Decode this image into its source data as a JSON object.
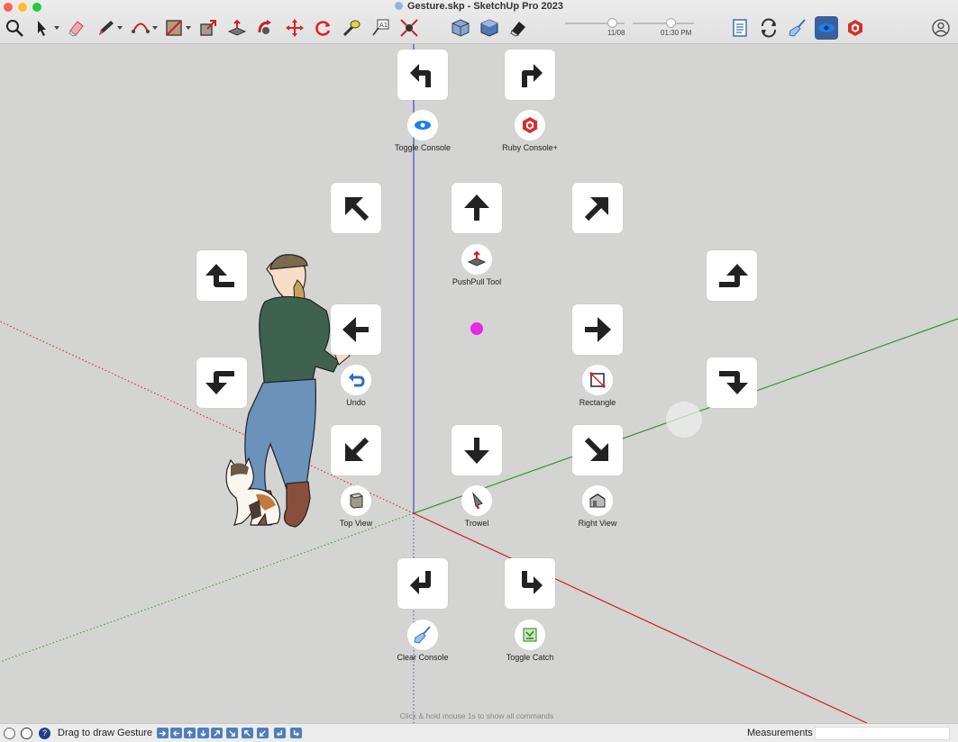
{
  "window": {
    "title": "Gesture.skp - SketchUp Pro 2023",
    "traffic_colors": [
      "#ff5f57",
      "#febc2e",
      "#28c840"
    ]
  },
  "toolbar": {
    "date_value": "11/08",
    "time_value": "01:30 PM",
    "tools": [
      "search-icon",
      "select-arrow-icon",
      "eraser-icon",
      "pencil-icon",
      "arc-icon",
      "rectangle-fill-icon",
      "scale-icon",
      "pushpull-icon",
      "follow-me-icon",
      "move-icon",
      "rotate-icon",
      "tape-measure-icon",
      "text-label-icon",
      "zoom-extents-icon",
      "iso-view-icon",
      "top-view-icon",
      "eraser-shadow-icon",
      "report-icon",
      "refresh-icon",
      "broom-icon",
      "eye-icon",
      "ruby-console-icon",
      "account-icon"
    ]
  },
  "viewport": {
    "hint": "Click & hold mouse 1s to show all commands",
    "axis_colors": {
      "blue": "#3b4ccf",
      "red": "#cc2222",
      "green": "#2f9a2f"
    },
    "accent_color": "#e829e0",
    "commands": [
      {
        "id": "toggle-console",
        "label": "Toggle Console",
        "icon": "eye-icon"
      },
      {
        "id": "ruby-console-plus",
        "label": "Ruby Console+",
        "icon": "ruby-icon"
      },
      {
        "id": "pushpull-tool",
        "label": "PushPull Tool",
        "icon": "pushpull-icon"
      },
      {
        "id": "undo",
        "label": "Undo",
        "icon": "undo-icon"
      },
      {
        "id": "rectangle",
        "label": "Rectangle",
        "icon": "rectangle-icon"
      },
      {
        "id": "top-view",
        "label": "Top View",
        "icon": "top-view-icon"
      },
      {
        "id": "trowel",
        "label": "Trowel",
        "icon": "trowel-icon"
      },
      {
        "id": "right-view",
        "label": "Right View",
        "icon": "right-view-icon"
      },
      {
        "id": "clear-console",
        "label": "Clear Console",
        "icon": "broom-icon"
      },
      {
        "id": "toggle-catch",
        "label": "Toggle Catch",
        "icon": "catch-icon"
      }
    ]
  },
  "statusbar": {
    "text": "Drag to draw Gesture",
    "measurements_label": "Measurements",
    "measurements_value": ""
  }
}
